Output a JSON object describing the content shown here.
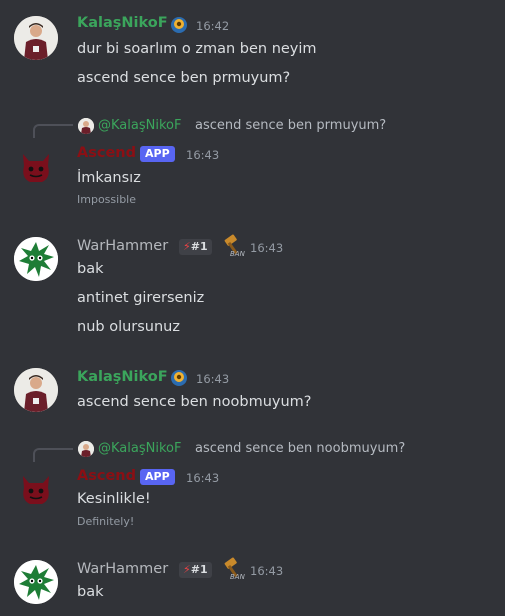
{
  "messages": [
    {
      "author": "KalaşNikoF",
      "time": "16:42",
      "lines": [
        "dur bi soarlım o zman ben neyim",
        "ascend sence ben prmuyum?"
      ],
      "avatar_icon": "person-avatar-icon",
      "badge_icon": "ring-badge-icon"
    },
    {
      "reply_to": "@KalaşNikoF",
      "reply_text": "ascend sence ben prmuyum?",
      "author": "Ascend",
      "app_badge": "APP",
      "time": "16:43",
      "lines": [
        "İmkansız"
      ],
      "subtext": "Impossible",
      "avatar_icon": "devil-avatar-icon"
    },
    {
      "author": "WarHammer",
      "rank_badge": "#1",
      "ban_label": "BAN",
      "time": "16:43",
      "lines": [
        "bak",
        "antinet girerseniz",
        "nub olursunuz"
      ],
      "avatar_icon": "green-ball-avatar-icon"
    },
    {
      "author": "KalaşNikoF",
      "time": "16:43",
      "lines": [
        "ascend sence ben noobmuyum?"
      ],
      "avatar_icon": "person-avatar-icon",
      "badge_icon": "ring-badge-icon"
    },
    {
      "reply_to": "@KalaşNikoF",
      "reply_text": "ascend sence ben noobmuyum?",
      "author": "Ascend",
      "app_badge": "APP",
      "time": "16:43",
      "lines": [
        "Kesinlikle!"
      ],
      "subtext": "Definitely!",
      "avatar_icon": "devil-avatar-icon"
    },
    {
      "author": "WarHammer",
      "rank_badge": "#1",
      "ban_label": "BAN",
      "time": "16:43",
      "lines": [
        "bak"
      ],
      "avatar_icon": "green-ball-avatar-icon"
    }
  ],
  "colors": {
    "background": "#313338",
    "kalas_name": "#3ba55c",
    "ascend_name": "#8b0f14",
    "app_badge": "#5865f2"
  }
}
